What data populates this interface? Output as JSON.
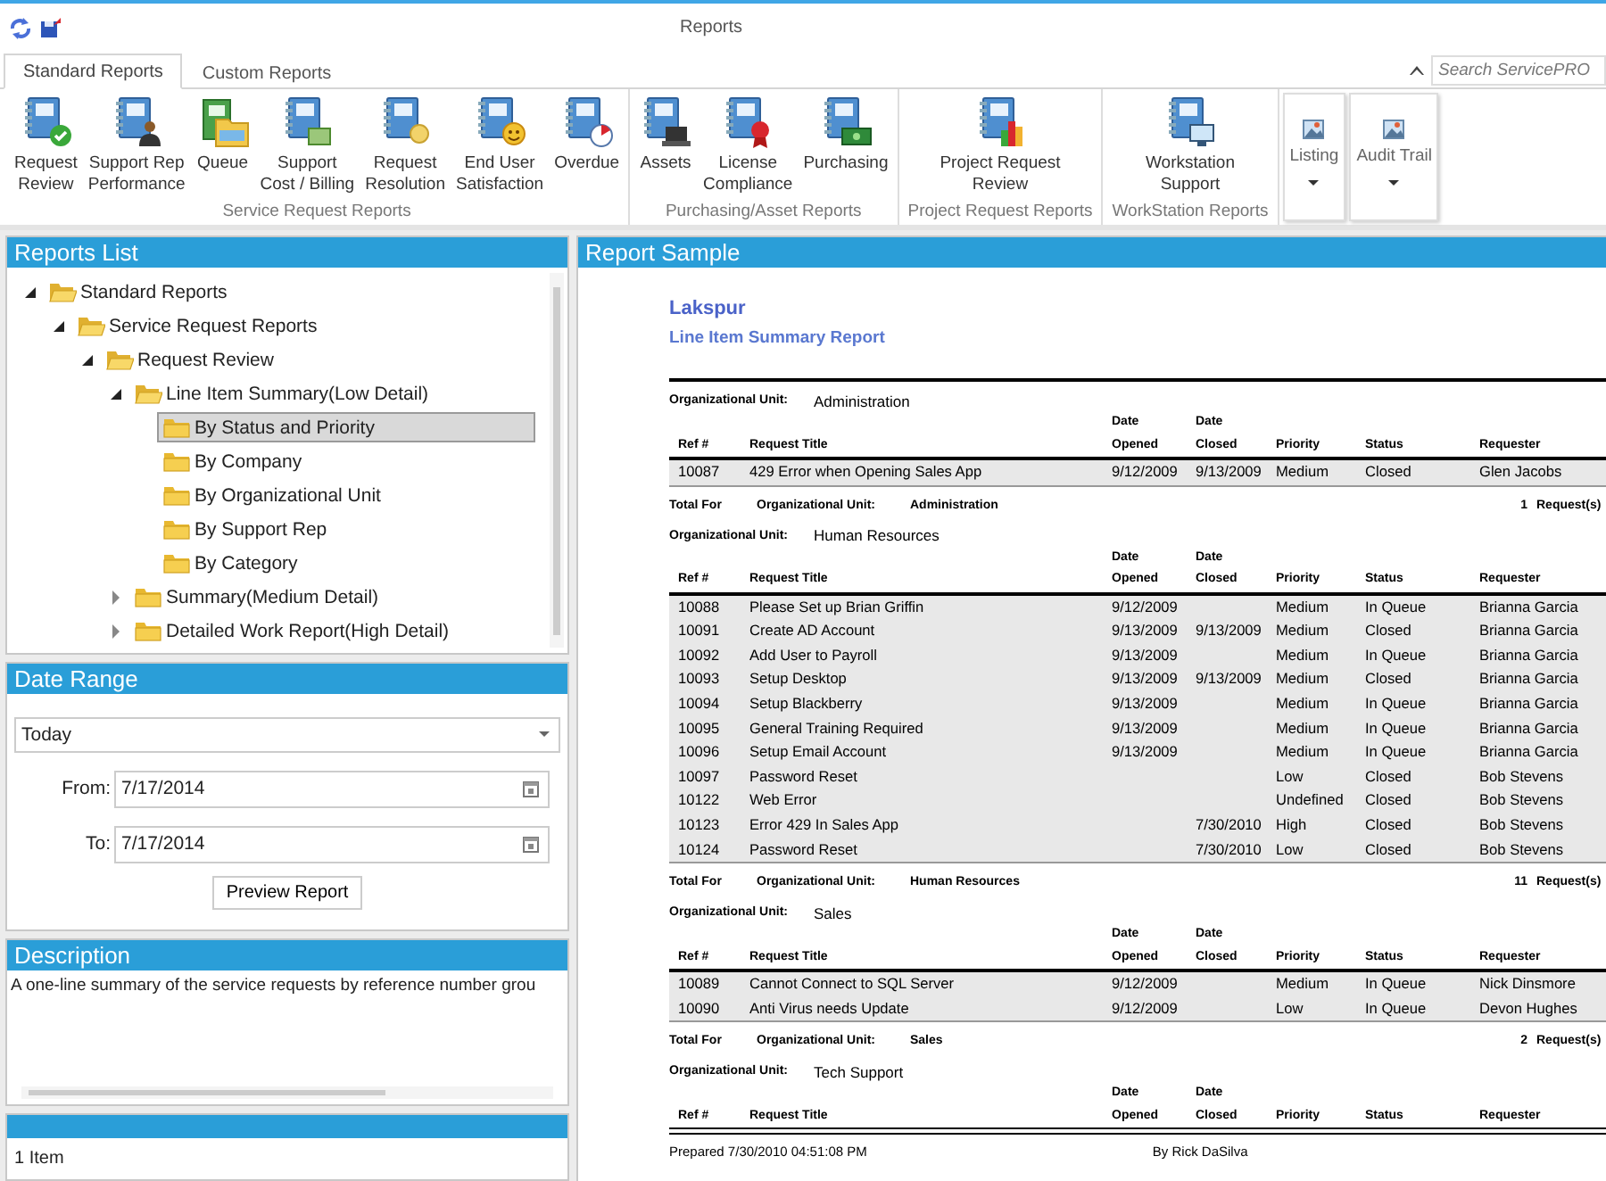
{
  "window": {
    "title": "Reports"
  },
  "tabs": [
    {
      "label": "Standard Reports",
      "selected": true
    },
    {
      "label": "Custom Reports",
      "selected": false
    }
  ],
  "search": {
    "placeholder": "Search ServicePRO"
  },
  "ribbon": {
    "groups": [
      {
        "label": "Service Request Reports",
        "buttons": [
          {
            "label": "Request\nReview",
            "kind": "check"
          },
          {
            "label": "Support Rep\nPerformance",
            "kind": "person"
          },
          {
            "label": "Queue",
            "kind": "queue"
          },
          {
            "label": "Support\nCost / Billing",
            "kind": "money"
          },
          {
            "label": "Request\nResolution",
            "kind": "bulb"
          },
          {
            "label": "End User\nSatisfaction",
            "kind": "smiley"
          },
          {
            "label": "Overdue",
            "kind": "clock"
          }
        ]
      },
      {
        "label": "Purchasing/Asset Reports",
        "buttons": [
          {
            "label": "Assets",
            "kind": "laptop"
          },
          {
            "label": "License\nCompliance",
            "kind": "award"
          },
          {
            "label": "Purchasing",
            "kind": "cash"
          }
        ]
      },
      {
        "label": "Project Request Reports",
        "buttons": [
          {
            "label": "Project Request\nReview",
            "kind": "chart"
          }
        ]
      },
      {
        "label": "WorkStation Reports",
        "buttons": [
          {
            "label": "Workstation\nSupport",
            "kind": "monitor"
          }
        ]
      }
    ],
    "menus": [
      {
        "label": "Listing"
      },
      {
        "label": "Audit Trail"
      }
    ]
  },
  "reports_list": {
    "title": "Reports List",
    "tree": [
      {
        "label": "Standard Reports",
        "expanded": true,
        "selected": false,
        "children": [
          {
            "label": "Service Request Reports",
            "expanded": true,
            "selected": false,
            "children": [
              {
                "label": "Request Review",
                "expanded": true,
                "selected": false,
                "children": [
                  {
                    "label": "Line Item Summary(Low Detail)",
                    "expanded": true,
                    "selected": false,
                    "children": [
                      {
                        "label": "By Status and Priority",
                        "selected": true
                      },
                      {
                        "label": "By Company",
                        "selected": false
                      },
                      {
                        "label": "By Organizational Unit",
                        "selected": false
                      },
                      {
                        "label": "By Support Rep",
                        "selected": false
                      },
                      {
                        "label": "By Category",
                        "selected": false
                      }
                    ]
                  },
                  {
                    "label": "Summary(Medium Detail)",
                    "expanded": false,
                    "selected": false
                  },
                  {
                    "label": "Detailed Work Report(High Detail)",
                    "expanded": false,
                    "selected": false
                  }
                ]
              }
            ]
          }
        ]
      }
    ]
  },
  "date_range": {
    "title": "Date Range",
    "preset": "Today",
    "from_label": "From:",
    "from": "7/17/2014",
    "to_label": "To:",
    "to": "7/17/2014",
    "button": "Preview Report"
  },
  "description": {
    "title": "Description",
    "text": "A one-line summary of the service requests by reference number grou"
  },
  "status_bar": {
    "text": "1 Item"
  },
  "report_sample": {
    "title": "Report Sample",
    "company": "Lakspur",
    "report_title": "Line Item Summary Report",
    "groups": [
      {
        "unit_label": "Organizational Unit:",
        "unit": "Administration",
        "columns": [
          "Ref #",
          "Request Title",
          "Date\nOpened",
          "Date\nClosed",
          "Priority",
          "Status",
          "Requester"
        ],
        "rows": [
          {
            "ref": "10087",
            "title": "429 Error when Opening Sales App",
            "opened": "9/12/2009",
            "closed": "9/13/2009",
            "priority": "Medium",
            "status": "Closed",
            "requester": "Glen Jacobs"
          }
        ],
        "total": {
          "label": "Total  For",
          "unit_label": "Organizational Unit:",
          "unit": "Administration",
          "count": "1",
          "suffix": "Request(s)"
        }
      },
      {
        "unit_label": "Organizational Unit:",
        "unit": "Human Resources",
        "columns": [
          "Ref #",
          "Request Title",
          "Date\nOpened",
          "Date\nClosed",
          "Priority",
          "Status",
          "Requester"
        ],
        "rows": [
          {
            "ref": "10088",
            "title": "Please Set up Brian Griffin",
            "opened": "9/12/2009",
            "priority": "Medium",
            "status": "In Queue",
            "requester": "Brianna Garcia"
          },
          {
            "ref": "10091",
            "title": "Create AD Account",
            "opened": "9/13/2009",
            "closed": "9/13/2009",
            "priority": "Medium",
            "status": "Closed",
            "requester": "Brianna Garcia"
          },
          {
            "ref": "10092",
            "title": "Add User to Payroll",
            "opened": "9/13/2009",
            "priority": "Medium",
            "status": "In Queue",
            "requester": "Brianna Garcia"
          },
          {
            "ref": "10093",
            "title": "Setup Desktop",
            "opened": "9/13/2009",
            "closed": "9/13/2009",
            "priority": "Medium",
            "status": "Closed",
            "requester": "Brianna Garcia"
          },
          {
            "ref": "10094",
            "title": "Setup Blackberry",
            "opened": "9/13/2009",
            "priority": "Medium",
            "status": "In Queue",
            "requester": "Brianna Garcia"
          },
          {
            "ref": "10095",
            "title": "General Training Required",
            "opened": "9/13/2009",
            "priority": "Medium",
            "status": "In Queue",
            "requester": "Brianna Garcia"
          },
          {
            "ref": "10096",
            "title": "Setup Email Account",
            "opened": "9/13/2009",
            "priority": "Medium",
            "status": "In Queue",
            "requester": "Brianna Garcia"
          },
          {
            "ref": "10097",
            "title": "Password Reset",
            "priority": "Low",
            "status": "Closed",
            "requester": "Bob Stevens"
          },
          {
            "ref": "10122",
            "title": "Web Error",
            "priority": "Undefined",
            "status": "Closed",
            "requester": "Bob Stevens"
          },
          {
            "ref": "10123",
            "title": "Error 429 In Sales App",
            "closed": "7/30/2010",
            "priority": "High",
            "status": "Closed",
            "requester": "Bob Stevens"
          },
          {
            "ref": "10124",
            "title": "Password Reset",
            "closed": "7/30/2010",
            "priority": "Low",
            "status": "Closed",
            "requester": "Bob Stevens"
          }
        ],
        "total": {
          "label": "Total  For",
          "unit_label": "Organizational Unit:",
          "unit": "Human Resources",
          "count": "11",
          "suffix": "Request(s)"
        }
      },
      {
        "unit_label": "Organizational Unit:",
        "unit": "Sales",
        "columns": [
          "Ref #",
          "Request Title",
          "Date\nOpened",
          "Date\nClosed",
          "Priority",
          "Status",
          "Requester"
        ],
        "rows": [
          {
            "ref": "10089",
            "title": "Cannot Connect to SQL Server",
            "opened": "9/12/2009",
            "priority": "Medium",
            "status": "In Queue",
            "requester": "Nick Dinsmore"
          },
          {
            "ref": "10090",
            "title": "Anti Virus needs Update",
            "opened": "9/12/2009",
            "priority": "Low",
            "status": "In Queue",
            "requester": "Devon Hughes"
          }
        ],
        "total": {
          "label": "Total  For",
          "unit_label": "Organizational Unit:",
          "unit": "Sales",
          "count": "2",
          "suffix": "Request(s)"
        }
      },
      {
        "unit_label": "Organizational Unit:",
        "unit": "Tech Support",
        "columns": [
          "Ref #",
          "Request Title",
          "Date\nOpened",
          "Date\nClosed",
          "Priority",
          "Status",
          "Requester"
        ]
      }
    ],
    "prepared": "Prepared 7/30/2010 04:51:08 PM",
    "author": "By Rick DaSilva"
  }
}
